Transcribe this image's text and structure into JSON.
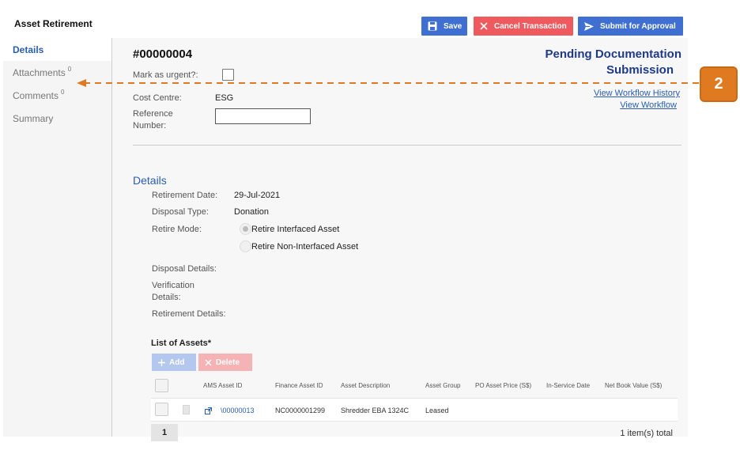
{
  "app": {
    "title": "Asset Retirement"
  },
  "toolbar": {
    "save_label": "Save",
    "cancel_label": "Cancel Transaction",
    "submit_label": "Submit for Approval"
  },
  "sidebar": {
    "items": [
      {
        "label": "Details",
        "count": ""
      },
      {
        "label": "Attachments",
        "count": "0"
      },
      {
        "label": "Comments",
        "count": "0"
      },
      {
        "label": "Summary",
        "count": ""
      }
    ]
  },
  "document": {
    "number": "#00000004",
    "status_line1": "Pending Documentation",
    "status_line2": "Submission",
    "urgent_label": "Mark as urgent?:",
    "cost_centre_label": "Cost Centre:",
    "cost_centre_value": "ESG",
    "reference_label_line1": "Reference",
    "reference_label_line2": "Number:",
    "workflow_history_link": "View Workflow History",
    "workflow_link": "View Workflow"
  },
  "details": {
    "section_title": "Details",
    "retirement_date_label": "Retirement Date:",
    "retirement_date_value": "29-Jul-2021",
    "disposal_type_label": "Disposal Type:",
    "disposal_type_value": "Donation",
    "retire_mode_label": "Retire Mode:",
    "retire_mode_options": [
      "Retire Interfaced Asset",
      "Retire Non-Interfaced Asset"
    ],
    "disposal_details_label": "Disposal Details:",
    "verification_label_line1": "Verification",
    "verification_label_line2": "Details:",
    "retirement_details_label": "Retirement Details:"
  },
  "assets": {
    "title": "List of Assets*",
    "add_label": "Add",
    "delete_label": "Delete",
    "columns": [
      "AMS Asset ID",
      "Finance Asset ID",
      "Asset Description",
      "Asset Group",
      "PO Asset Price (S$)",
      "In-Service Date",
      "Net Book Value (S$)"
    ],
    "rows": [
      {
        "ams_id": "\\00000013",
        "finance_id": "NC0000001299",
        "description": "Shredder EBA 1324C",
        "group": "Leased",
        "price": "",
        "in_service": "",
        "nbv": ""
      }
    ],
    "page": "1",
    "total": "1 item(s) total"
  },
  "callout": {
    "number": "2"
  },
  "colors": {
    "primary": "#3f6fd1",
    "danger": "#ef5a5f",
    "callout": "#e07a20",
    "link": "#2a5db0",
    "status": "#1e3a8a"
  }
}
